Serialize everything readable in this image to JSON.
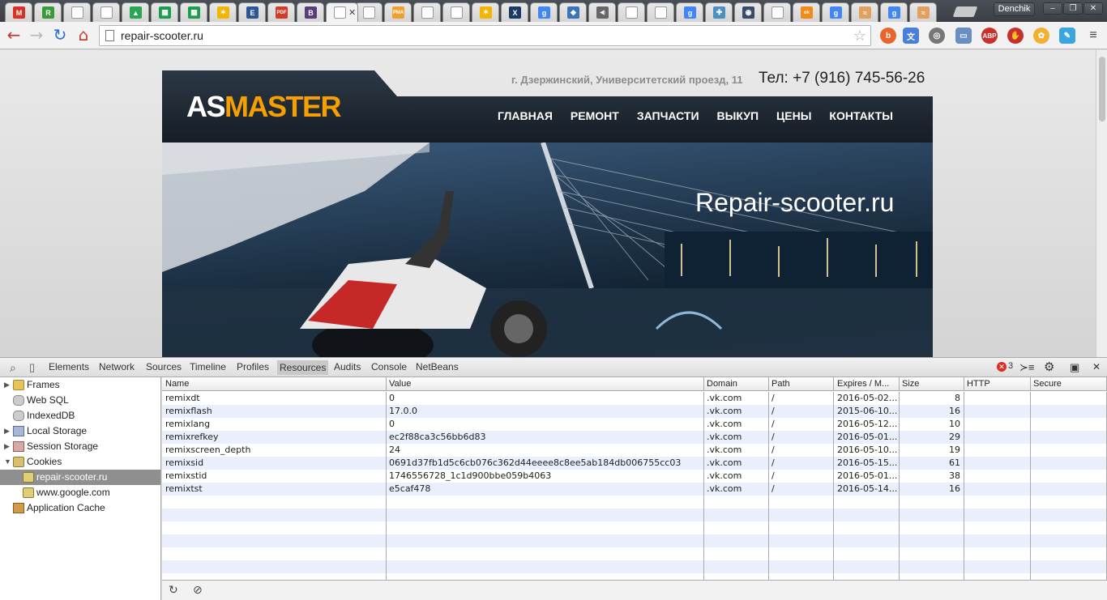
{
  "browser": {
    "tabs": [
      {
        "icon": "gmail-icon",
        "glyph": "M",
        "color": "#d93025"
      },
      {
        "icon": "vkontakte-icon",
        "glyph": "R",
        "color": "#3a9a3a"
      },
      {
        "icon": "page-icon",
        "glyph": "",
        "color": "#ffffff"
      },
      {
        "icon": "page-icon",
        "glyph": "",
        "color": "#ffffff"
      },
      {
        "icon": "google-drive-icon",
        "glyph": "▲",
        "color": "#2aa455"
      },
      {
        "icon": "google-sheets-icon",
        "glyph": "▦",
        "color": "#1b9e4b"
      },
      {
        "icon": "google-sheets-icon",
        "glyph": "▦",
        "color": "#1b9e4b"
      },
      {
        "icon": "colorful-icon",
        "glyph": "✶",
        "color": "#f4b400"
      },
      {
        "icon": "editor-icon",
        "glyph": "E",
        "color": "#2b5797"
      },
      {
        "icon": "pdf-icon",
        "glyph": "PDF",
        "color": "#d23a2a"
      },
      {
        "icon": "bootstrap-icon",
        "glyph": "B",
        "color": "#563d7c"
      },
      {
        "icon": "new-tab-icon",
        "glyph": "",
        "color": "#ffffff",
        "active": true
      },
      {
        "icon": "page-icon",
        "glyph": "",
        "color": "#ffffff"
      },
      {
        "icon": "pma-icon",
        "glyph": "PMA",
        "color": "#f0a030"
      },
      {
        "icon": "page-icon",
        "glyph": "",
        "color": "#ffffff"
      },
      {
        "icon": "page-icon",
        "glyph": "",
        "color": "#ffffff"
      },
      {
        "icon": "colorful-icon",
        "glyph": "✶",
        "color": "#f4b400"
      },
      {
        "icon": "xe-icon",
        "glyph": "X",
        "color": "#1a3a66"
      },
      {
        "icon": "google-icon",
        "glyph": "g",
        "color": "#4285f4"
      },
      {
        "icon": "network-icon",
        "glyph": "◆",
        "color": "#3b73b9"
      },
      {
        "icon": "speaker-icon",
        "glyph": "◀)",
        "color": "#666666"
      },
      {
        "icon": "page-icon",
        "glyph": "",
        "color": "#ffffff"
      },
      {
        "icon": "page-icon",
        "glyph": "",
        "color": "#ffffff"
      },
      {
        "icon": "google-icon",
        "glyph": "g",
        "color": "#4285f4"
      },
      {
        "icon": "puzzle-icon",
        "glyph": "✚",
        "color": "#4a90c2"
      },
      {
        "icon": "eye-icon",
        "glyph": "◉",
        "color": "#3a4a6a"
      },
      {
        "icon": "page-icon",
        "glyph": "",
        "color": "#ffffff"
      },
      {
        "icon": "odnoklassniki-icon",
        "glyph": "ok",
        "color": "#f28a1a"
      },
      {
        "icon": "google-icon",
        "glyph": "g",
        "color": "#4285f4"
      },
      {
        "icon": "loading-icon",
        "glyph": "≈",
        "color": "#e0a060"
      },
      {
        "icon": "google-icon",
        "glyph": "g",
        "color": "#4285f4"
      },
      {
        "icon": "loading-icon",
        "glyph": "≈",
        "color": "#e0a060"
      }
    ],
    "user": "Denchik",
    "url": "repair-scooter.ru"
  },
  "site": {
    "logo_part1": "AS",
    "logo_part2": "MASTER",
    "address": "г. Дзержинский, Университетский проезд, 11",
    "phone": "Тел: +7 (916) 745-56-26",
    "menu": [
      "ГЛАВНАЯ",
      "РЕМОНТ",
      "ЗАПЧАСТИ",
      "ВЫКУП",
      "ЦЕНЫ",
      "КОНТАКТЫ"
    ],
    "hero_title": "Repair-scooter.ru",
    "accent": "#f5a000"
  },
  "devtools": {
    "tabs": [
      "Elements",
      "Network",
      "Sources",
      "Timeline",
      "Profiles",
      "Resources",
      "Audits",
      "Console",
      "NetBeans"
    ],
    "selected_tab": "Resources",
    "error_count": "3",
    "sidebar": {
      "frames": "Frames",
      "websql": "Web SQL",
      "indexeddb": "IndexedDB",
      "local_storage": "Local Storage",
      "session_storage": "Session Storage",
      "cookies": "Cookies",
      "cookie_site_1": "repair-scooter.ru",
      "cookie_site_2": "www.google.com",
      "app_cache": "Application Cache"
    },
    "columns": [
      "Name",
      "Value",
      "Domain",
      "Path",
      "Expires / M...",
      "Size",
      "HTTP",
      "Secure"
    ],
    "cookies": [
      [
        "remixdt",
        "0",
        ".vk.com",
        "/",
        "2016-05-02...",
        "8",
        "",
        ""
      ],
      [
        "remixflash",
        "17.0.0",
        ".vk.com",
        "/",
        "2015-06-10...",
        "16",
        "",
        ""
      ],
      [
        "remixlang",
        "0",
        ".vk.com",
        "/",
        "2016-05-12...",
        "10",
        "",
        ""
      ],
      [
        "remixrefkey",
        "ec2f88ca3c56bb6d83",
        ".vk.com",
        "/",
        "2016-05-01...",
        "29",
        "",
        ""
      ],
      [
        "remixscreen_depth",
        "24",
        ".vk.com",
        "/",
        "2016-05-10...",
        "19",
        "",
        ""
      ],
      [
        "remixsid",
        "0691d37fb1d5c6cb076c362d44eeee8c8ee5ab184db006755cc03",
        ".vk.com",
        "/",
        "2016-05-15...",
        "61",
        "",
        ""
      ],
      [
        "remixstid",
        "1746556728_1c1d900bbe059b4063",
        ".vk.com",
        "/",
        "2016-05-01...",
        "38",
        "",
        ""
      ],
      [
        "remixtst",
        "e5caf478",
        ".vk.com",
        "/",
        "2016-05-14...",
        "16",
        "",
        ""
      ]
    ]
  }
}
